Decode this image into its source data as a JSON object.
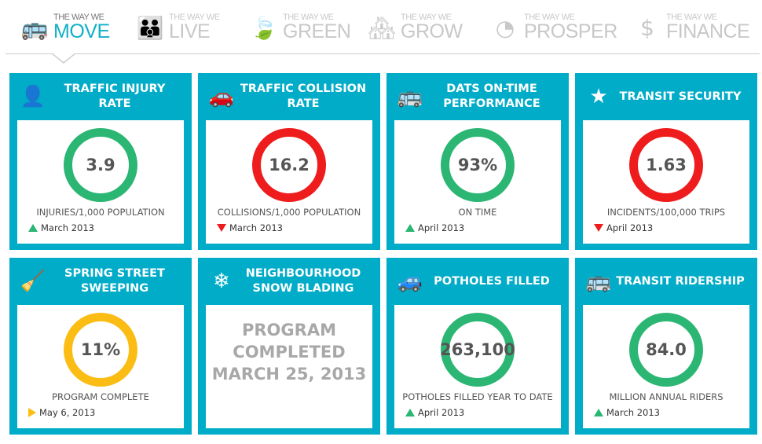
{
  "nav": {
    "items": [
      {
        "small": "THE WAY WE",
        "big": "MOVE",
        "icon": "bus-icon",
        "active": true
      },
      {
        "small": "THE WAY WE",
        "big": "LIVE",
        "icon": "family-icon",
        "active": false
      },
      {
        "small": "THE WAY WE",
        "big": "GREEN",
        "icon": "leaf-icon",
        "active": false
      },
      {
        "small": "THE WAY WE",
        "big": "GROW",
        "icon": "buildings-icon",
        "active": false
      },
      {
        "small": "THE WAY WE",
        "big": "PROSPER",
        "icon": "pie-chart-icon",
        "active": false
      },
      {
        "small": "THE WAY WE",
        "big": "FINANCE",
        "icon": "dollar-icon",
        "active": false
      }
    ]
  },
  "colors": {
    "accent": "#00acc8",
    "good": "#2bb673",
    "bad": "#ee1c1c",
    "neutral": "#fbbd13"
  },
  "cards": [
    {
      "title": "TRAFFIC INJURY RATE",
      "icon": "injured-person-icon",
      "value": "3.9",
      "unit": "INJURIES/1,000 POPULATION",
      "date": "March 2013",
      "trend": "up",
      "status": "green"
    },
    {
      "title": "TRAFFIC COLLISION RATE",
      "icon": "car-crash-icon",
      "value": "16.2",
      "unit": "COLLISIONS/1,000 POPULATION",
      "date": "March 2013",
      "trend": "down",
      "status": "red"
    },
    {
      "title": "DATS ON-TIME PERFORMANCE",
      "icon": "bus-icon",
      "value": "93%",
      "unit": "ON TIME",
      "date": "April 2013",
      "trend": "up",
      "status": "green"
    },
    {
      "title": "TRANSIT SECURITY",
      "icon": "shield-star-icon",
      "value": "1.63",
      "unit": "INCIDENTS/100,000 TRIPS",
      "date": "April 2013",
      "trend": "down",
      "status": "red"
    },
    {
      "title": "SPRING STREET SWEEPING",
      "icon": "broom-icon",
      "value": "11%",
      "unit": "PROGRAM COMPLETE",
      "date": "May 6, 2013",
      "trend": "flat",
      "status": "yellow"
    },
    {
      "title": "NEIGHBOURHOOD SNOW BLADING",
      "icon": "snowflake-icon",
      "message": "PROGRAM COMPLETED MARCH 25, 2013"
    },
    {
      "title": "POTHOLES FILLED",
      "icon": "car-pothole-icon",
      "value": "263,100",
      "unit": "POTHOLES FILLED YEAR TO DATE",
      "date": "April 2013",
      "trend": "up",
      "status": "green"
    },
    {
      "title": "TRANSIT RIDERSHIP",
      "icon": "bus-icon",
      "value": "84.0",
      "unit": "MILLION ANNUAL RIDERS",
      "date": "March 2013",
      "trend": "up",
      "status": "green"
    }
  ]
}
